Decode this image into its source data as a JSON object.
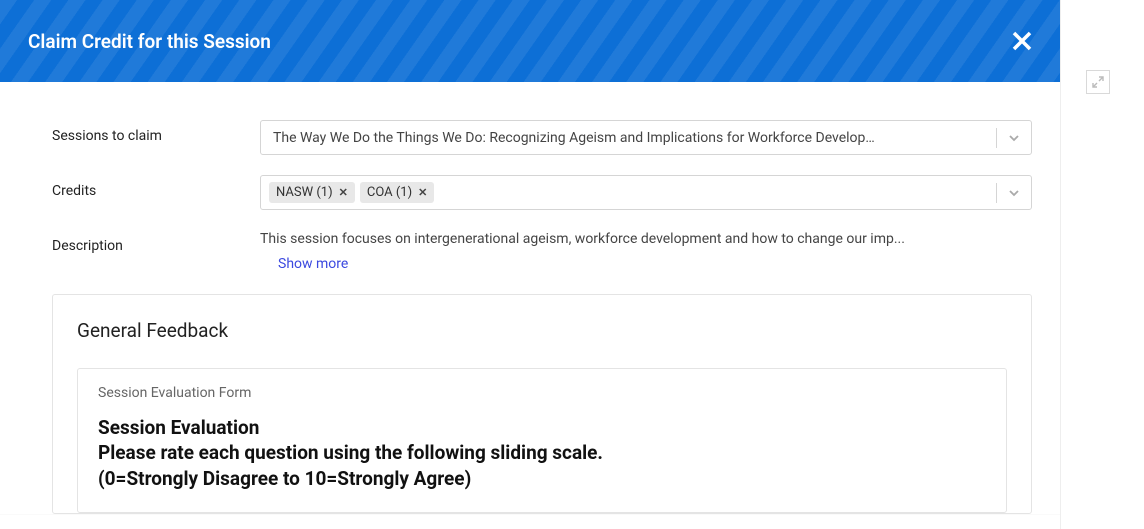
{
  "modal": {
    "title": "Claim Credit for this Session"
  },
  "form": {
    "sessions_label": "Sessions to claim",
    "sessions_value": "The Way We Do the Things We Do: Recognizing Ageism and Implications for Workforce Develop…",
    "credits_label": "Credits",
    "credits_chips": [
      {
        "label": "NASW (1)"
      },
      {
        "label": "COA (1)"
      }
    ],
    "description_label": "Description",
    "description_text": "This session focuses on intergenerational ageism, workforce development and how to change our imp...",
    "show_more": "Show more"
  },
  "feedback": {
    "panel_title": "General Feedback",
    "card_subtitle": "Session Evaluation Form",
    "line1": "Session Evaluation",
    "line2": "Please rate each question using the following sliding scale.",
    "line3": "(0=Strongly Disagree to 10=Strongly Agree)"
  }
}
